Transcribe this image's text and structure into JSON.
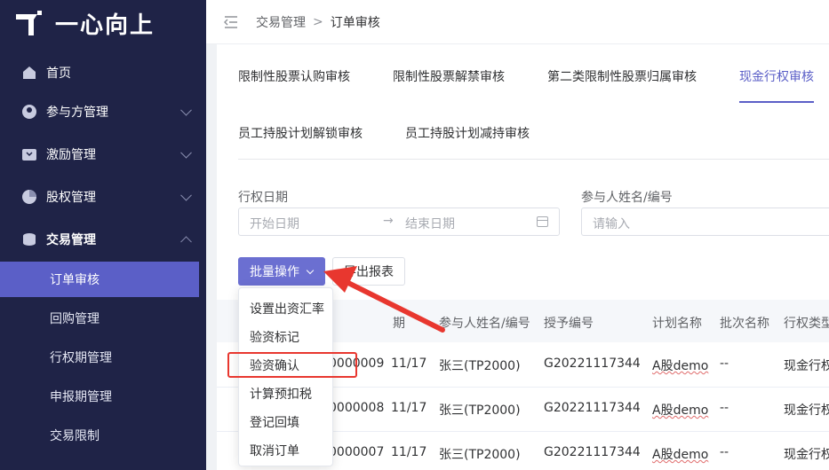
{
  "app": {
    "brand": "一心向上"
  },
  "sidebar": {
    "menu": [
      {
        "label": "首页",
        "icon": "home-icon"
      },
      {
        "label": "参与方管理",
        "icon": "participant-icon"
      },
      {
        "label": "激励管理",
        "icon": "incentive-icon"
      },
      {
        "label": "股权管理",
        "icon": "equity-icon"
      },
      {
        "label": "交易管理",
        "icon": "trade-icon"
      }
    ],
    "submenu": [
      {
        "label": "订单审核",
        "active": true
      },
      {
        "label": "回购管理"
      },
      {
        "label": "行权期管理"
      },
      {
        "label": "申报期管理"
      },
      {
        "label": "交易限制"
      }
    ]
  },
  "header": {
    "breadcrumb": [
      "交易管理",
      "订单审核"
    ]
  },
  "tabs": [
    {
      "label": "限制性股票认购审核"
    },
    {
      "label": "限制性股票解禁审核"
    },
    {
      "label": "第二类限制性股票归属审核"
    },
    {
      "label": "现金行权审核",
      "active": true
    },
    {
      "label": "员工持股计划解锁审核"
    },
    {
      "label": "员工持股计划减持审核"
    }
  ],
  "filters": {
    "date_label": "行权日期",
    "start_placeholder": "开始日期",
    "end_placeholder": "结束日期",
    "name_label": "参与人姓名/编号",
    "name_placeholder": "请输入"
  },
  "actions": {
    "batch_label": "批量操作",
    "export_label": "导出报表"
  },
  "dropdown": {
    "items": [
      "设置出资汇率",
      "验资标记",
      "验资确认",
      "计算预扣税",
      "登记回填",
      "取消订单"
    ],
    "highlighted": "验资确认"
  },
  "table": {
    "headers": [
      "期",
      "参与人姓名/编号",
      "授予编号",
      "计划名称",
      "批次名称",
      "行权类型"
    ],
    "rows": [
      {
        "order_tail": "0000009",
        "date_tail": "11/17",
        "participant": "张三(TP2000)",
        "grant_no": "G20221117344",
        "plan": "A股demo",
        "batch": "--",
        "type": "现金行权"
      },
      {
        "order_tail": "0000008",
        "date_tail": "11/17",
        "participant": "张三(TP2000)",
        "grant_no": "G20221117344",
        "plan": "A股demo",
        "batch": "--",
        "type": "现金行权"
      },
      {
        "order_tail": "0000007",
        "date_tail": "11/17",
        "participant": "张三(TP2000)",
        "grant_no": "G20221117344",
        "plan": "A股demo",
        "batch": "--",
        "type": "现金行权"
      }
    ]
  },
  "colors": {
    "sidebar_bg": "#1f2347",
    "accent": "#5b5fc7",
    "annotation": "#e8372f"
  }
}
